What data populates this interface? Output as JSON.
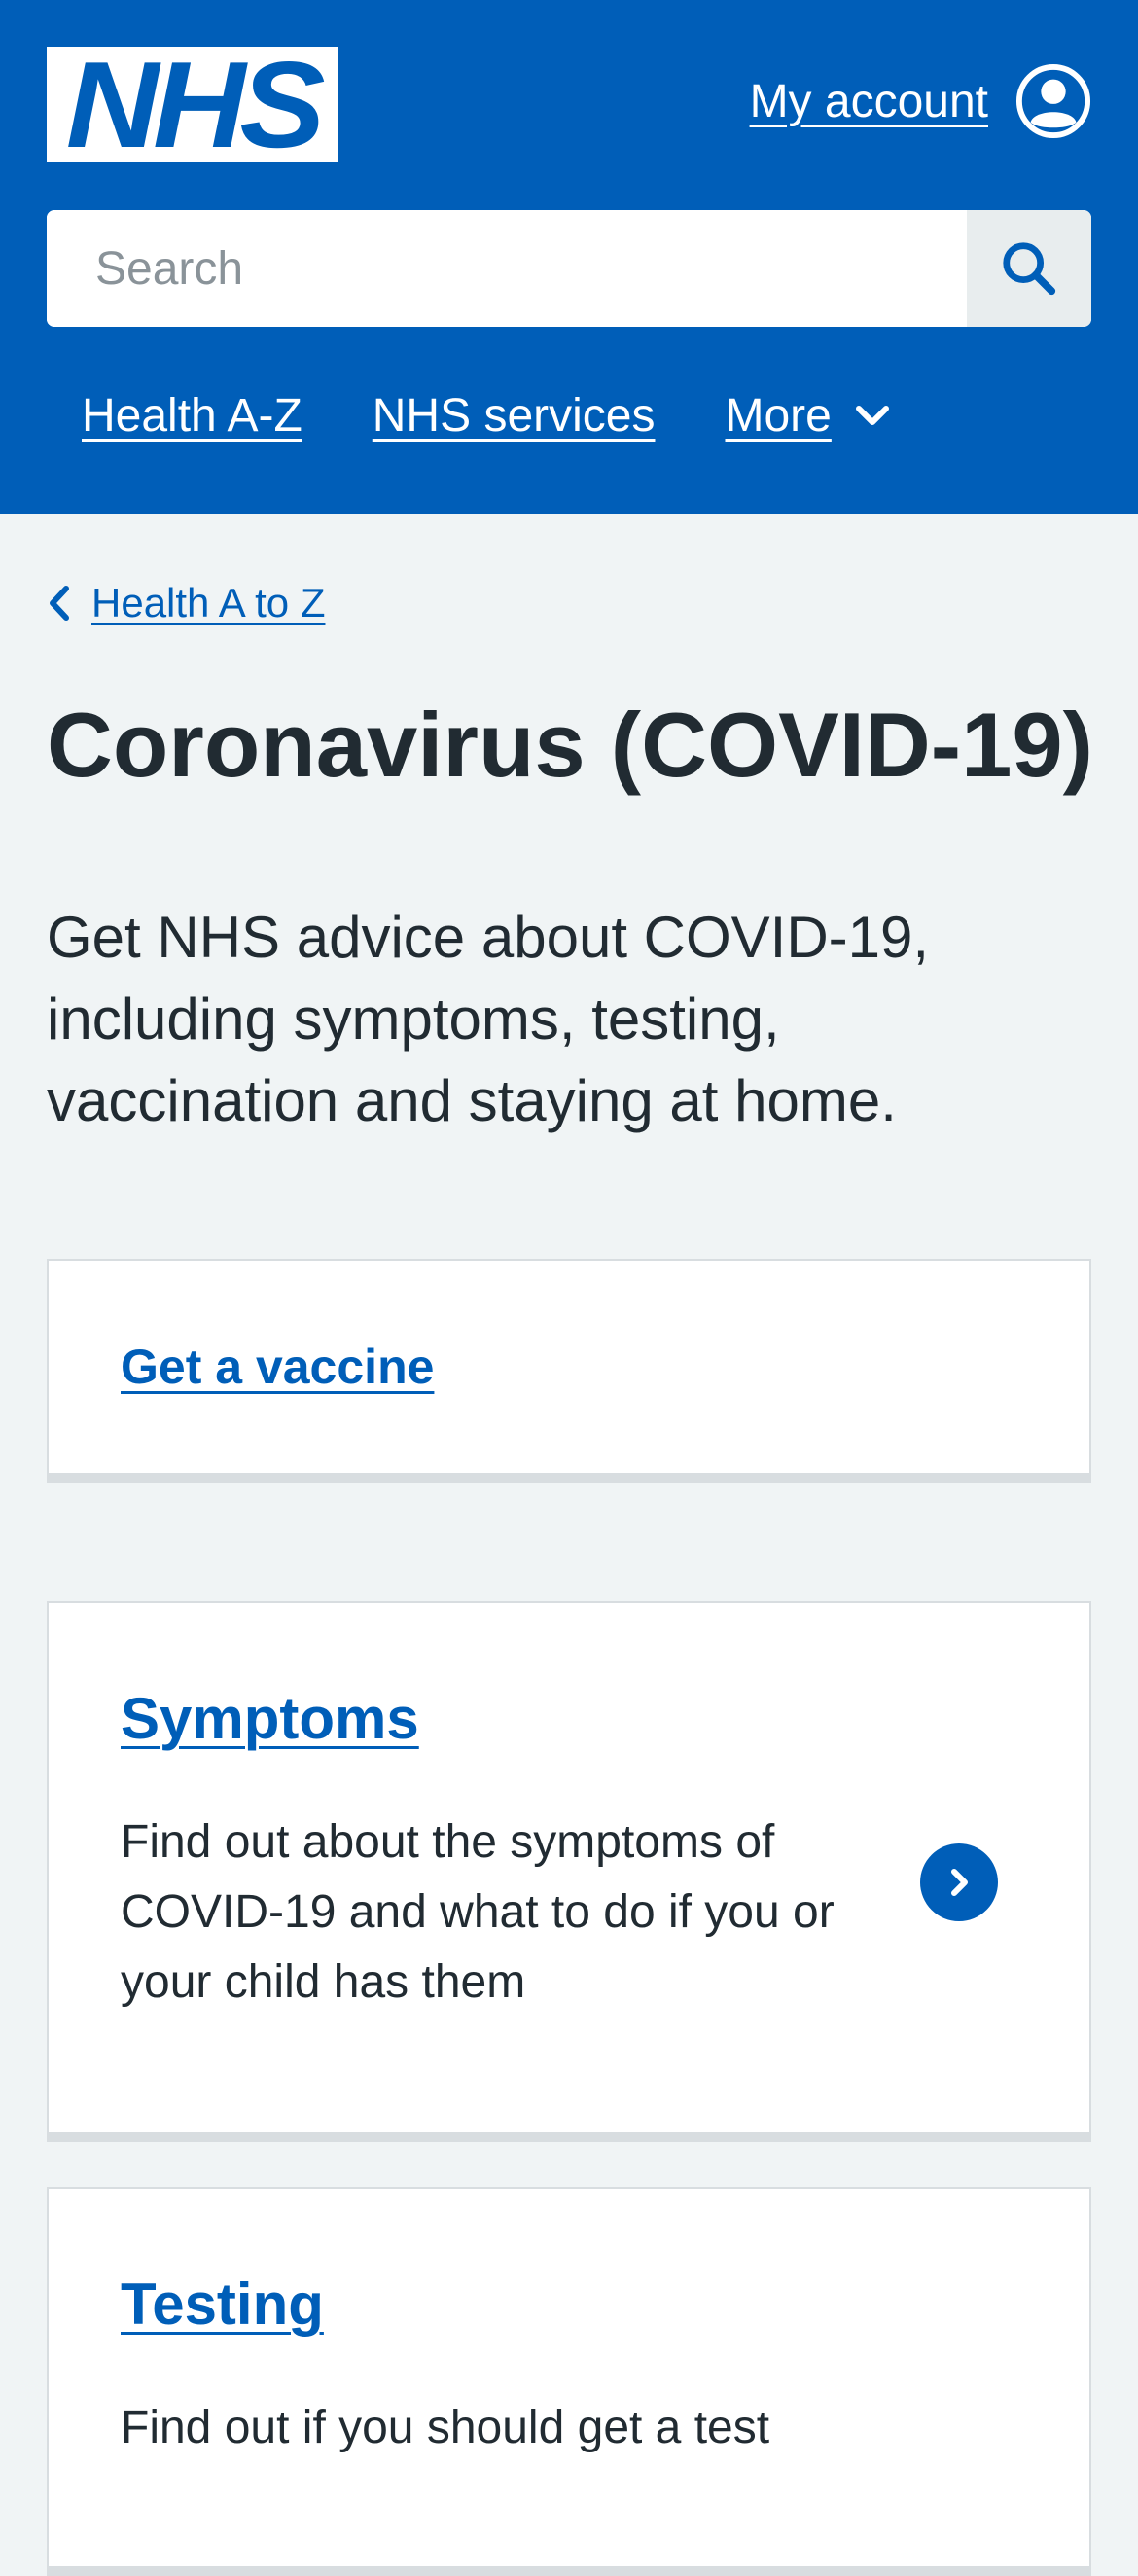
{
  "header": {
    "logo_text": "NHS",
    "account_label": "My account",
    "search_placeholder": "Search",
    "nav": [
      {
        "label": "Health A-Z"
      },
      {
        "label": "NHS services"
      },
      {
        "label": "More"
      }
    ]
  },
  "breadcrumb": {
    "label": "Health A to Z"
  },
  "page": {
    "title": "Coronavirus (COVID-19)",
    "lead": "Get NHS advice about COVID-19, including symptoms, testing, vaccination and staying at home."
  },
  "cards": [
    {
      "title": "Get a vaccine",
      "description": ""
    },
    {
      "title": "Symptoms",
      "description": "Find out about the symptoms of COVID-19 and what to do if you or your child has them"
    },
    {
      "title": "Testing",
      "description": "Find out if you should get a test"
    }
  ],
  "colors": {
    "brand_blue": "#005eb8",
    "page_background": "#f0f4f5",
    "text": "#212b32",
    "border": "#d8dde0"
  },
  "icons": [
    "account-icon",
    "search-icon",
    "chevron-down-icon",
    "chevron-left-icon",
    "chevron-right-circle-icon"
  ]
}
